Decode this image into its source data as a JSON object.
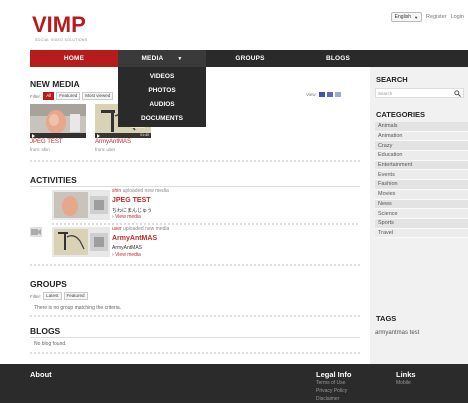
{
  "header": {
    "logo_text": "VIMP",
    "logo_sub": "SOCIAL VIDEO SOLUTIONS",
    "language": "English",
    "register": "Register",
    "login": "Login"
  },
  "nav": {
    "home": "HOME",
    "media": "MEDIA",
    "groups": "GROUPS",
    "blogs": "BLOGS"
  },
  "media_menu": [
    "VIDEOS",
    "PHOTOS",
    "AUDIOS",
    "DOCUMENTS"
  ],
  "new_media": {
    "title": "NEW MEDIA",
    "filter_label": "Filter:",
    "filters": [
      "All",
      "Featured",
      "Most viewed"
    ],
    "view_label": "View:",
    "items": [
      {
        "title": "JPEG TEST",
        "from_label": "from:",
        "user": "shin",
        "duration": ""
      },
      {
        "title": "ArmyAntMAS",
        "from_label": "from:",
        "user": "user",
        "duration": "01:40"
      }
    ]
  },
  "activities": {
    "title": "ACTIVITIES",
    "items": [
      {
        "user": "shin",
        "action": "uploaded new media",
        "title": "JPEG TEST",
        "description": "ちわにまんじゅう",
        "link": "View media"
      },
      {
        "user": "user",
        "action": "uploaded new media",
        "title": "ArmyAntMAS",
        "description": "ArmyAntMAS",
        "link": "View media"
      }
    ]
  },
  "groups": {
    "title": "GROUPS",
    "filter_label": "Filter:",
    "filters": [
      "Latest",
      "Featured"
    ],
    "empty": "There is no group matching the criteria."
  },
  "blogs": {
    "title": "BLOGS",
    "empty": "No blog found."
  },
  "sidebar": {
    "search_title": "SEARCH",
    "search_placeholder": "Search",
    "categories_title": "CATEGORIES",
    "categories": [
      "Animals",
      "Animation",
      "Crazy",
      "Education",
      "Entertainment",
      "Events",
      "Fashion",
      "Movies",
      "News",
      "Science",
      "Sports",
      "Travel"
    ],
    "tags_title": "TAGS",
    "tags": "armyantmas test"
  },
  "footer": {
    "about": "About",
    "legal_title": "Legal Info",
    "legal_links": [
      "Terms of Use",
      "Privacy Policy",
      "Disclaimer"
    ],
    "links_title": "Links",
    "links": [
      "Mobile"
    ]
  },
  "colors": {
    "brand": "#b71c1c",
    "nav_bg": "#2a2a2a",
    "footer_bg": "#2b2b2b"
  }
}
